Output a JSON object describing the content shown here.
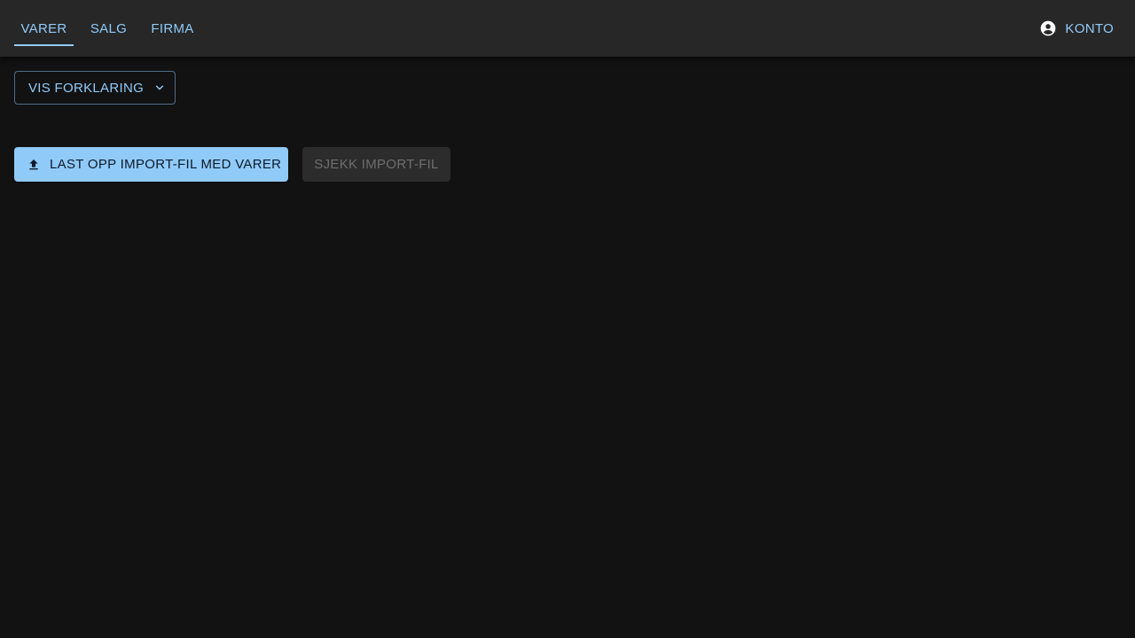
{
  "nav": {
    "tabs": [
      {
        "label": "VARER",
        "active": true
      },
      {
        "label": "SALG",
        "active": false
      },
      {
        "label": "FIRMA",
        "active": false
      }
    ],
    "account": {
      "label": "KONTO",
      "icon": "account-circle-icon"
    }
  },
  "main": {
    "explain_button": {
      "label": "VIS FORKLARING",
      "icon": "chevron-down-icon"
    },
    "upload_button": {
      "label": "LAST OPP IMPORT-FIL MED VARER",
      "icon": "upload-icon"
    },
    "check_button": {
      "label": "SJEKK IMPORT-FIL",
      "disabled": true
    }
  },
  "colors": {
    "background": "#121212",
    "appbar": "#272727",
    "accent": "#90caf9",
    "disabled_bg": "#2c2c2c",
    "disabled_text": "#6e6e6e"
  }
}
